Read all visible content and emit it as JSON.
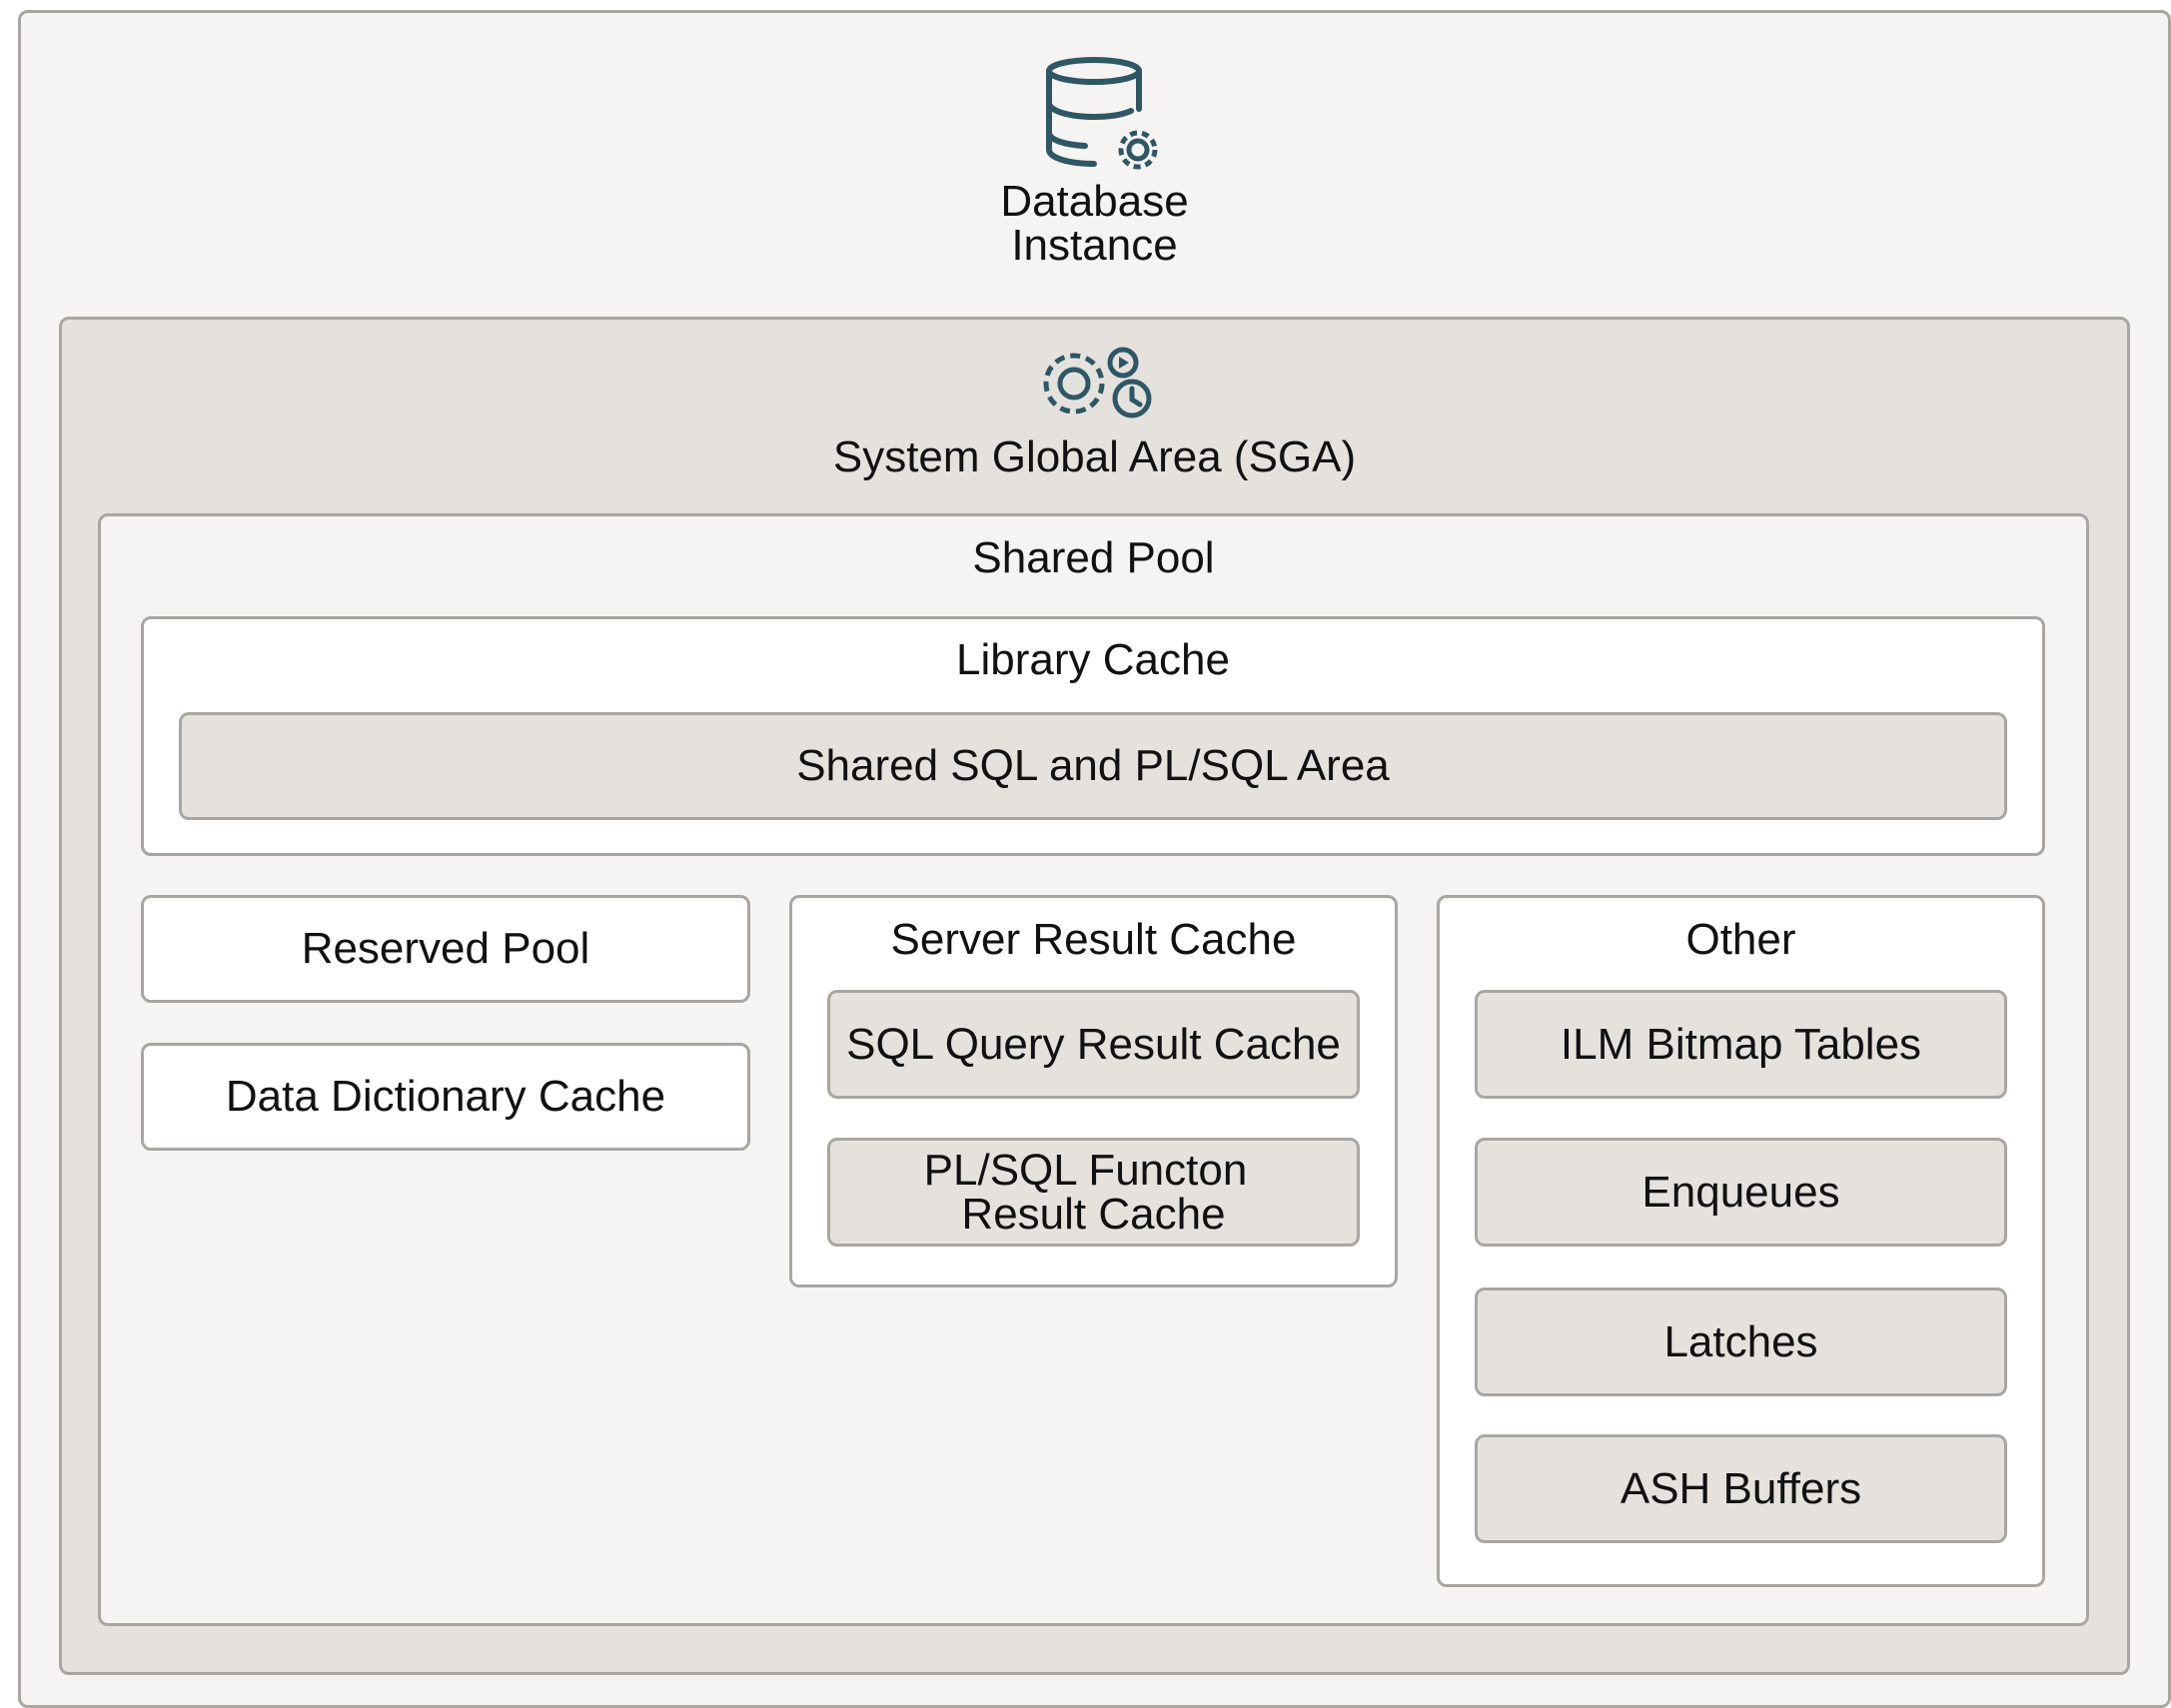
{
  "instance": {
    "title_line1": "Database",
    "title_line2": "Instance",
    "icon": "database-gear-icon"
  },
  "sga": {
    "title": "System Global Area (SGA)",
    "icon": "gears-clock-icon"
  },
  "shared_pool": {
    "title": "Shared Pool",
    "library_cache": {
      "title": "Library Cache",
      "shared_sql_area": "Shared SQL and PL/SQL Area"
    },
    "reserved_pool": "Reserved Pool",
    "data_dictionary_cache": "Data Dictionary Cache",
    "server_result_cache": {
      "title": "Server Result Cache",
      "sql_query_result_cache": "SQL Query Result Cache",
      "plsql_function_result_cache_line1": "PL/SQL Functon",
      "plsql_function_result_cache_line2": "Result Cache"
    },
    "other": {
      "title": "Other",
      "items": [
        "ILM Bitmap Tables",
        "Enqueues",
        "Latches",
        "ASH Buffers"
      ]
    }
  },
  "colors": {
    "icon": "#2e5766",
    "border": "#a9a6a1",
    "light_fill": "#f5f4f2",
    "grey_fill": "#e5e2de",
    "white_fill": "#ffffff"
  }
}
